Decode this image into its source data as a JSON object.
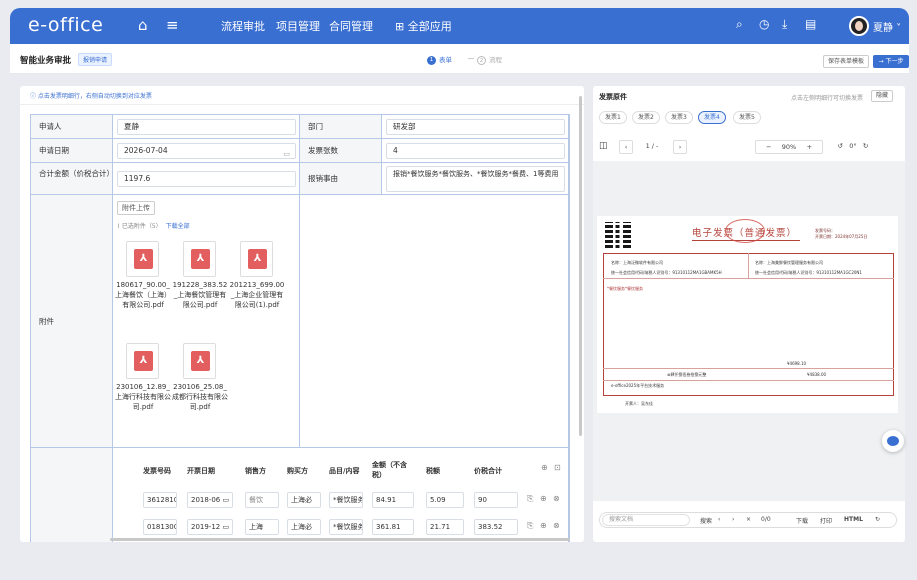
{
  "app": {
    "logo": "e-office",
    "username": "夏静"
  },
  "nav": {
    "links": [
      "流程审批",
      "项目管理",
      "合同管理"
    ],
    "all_apps": "全部应用"
  },
  "sub": {
    "title": "智能业务审批",
    "tag": "报销申请",
    "step1_num": "1",
    "step1": "表单",
    "step2_num": "2",
    "step2": "流程",
    "save_template": "保存表单模板",
    "next": "→ 下一步"
  },
  "form": {
    "hint": "点击发票明细行，右侧自动切换到对应发票",
    "applicant_label": "申请人",
    "applicant": "夏静",
    "dept_label": "部门",
    "dept": "研发部",
    "date_label": "申请日期",
    "date": "2026-07-04",
    "count_label": "发票张数",
    "count": "4",
    "total_label": "合计金额（价税合计）",
    "total": "1197.6",
    "reason_label": "报销事由",
    "reason": "报销*餐饮服务*餐饮服务、*餐饮服务*餐费、1等费用",
    "attachment_label": "附件",
    "upload": "附件上传",
    "selected": "已选附件（5）",
    "download_all": "下载全部",
    "files": [
      {
        "name": "180617_90.00_上海餐饮（上海）有限公司.pdf"
      },
      {
        "name": "191228_383.52_上海餐饮管理有限公司.pdf"
      },
      {
        "name": "201213_699.00_上海企业管理有限公司(1).pdf"
      },
      {
        "name": "230106_12.89_上海行科技有限公司.pdf"
      },
      {
        "name": "230106_25.08_成都行科技有限公司.pdf"
      }
    ]
  },
  "detail": {
    "headers": [
      "发票号码",
      "开票日期",
      "销售方",
      "购买方",
      "品目/内容",
      "金额（不含税）",
      "税额",
      "价税合计"
    ],
    "rows": [
      [
        "3612810",
        "2018-06",
        "餐饮",
        "上海必",
        "*餐饮服务",
        "84.91",
        "5.09",
        "90"
      ],
      [
        "0181300",
        "2019-12",
        "上海",
        "上海必",
        "*餐饮服务",
        "361.81",
        "21.71",
        "383.52"
      ]
    ]
  },
  "invoice": {
    "title": "发票原件",
    "hint": "点击左侧明细行可切换发票",
    "hide": "隐藏",
    "tabs": [
      "发票1",
      "发票2",
      "发票3",
      "发票4",
      "发票5"
    ],
    "page": "1 / -",
    "zoom": "90%",
    "rotation": "0°",
    "doc_title": "电子发票（普通发票）",
    "buyer": "名称：上海泛微软件有限公司",
    "buyer_tax": "统一社会信用代码/纳税人识别号：91310112MA1GBAMK5H",
    "seller": "名称：上海美鲜餐饮管理服务有限公司",
    "seller_tax": "统一社会信用代码/纳税人识别号：91310112MA1GC20N1",
    "item": "*餐饮服务*餐饮服务",
    "amount": "¥4698.10",
    "total_upper": "肆仟捌佰叁拾捌元整",
    "total_lower": "¥4838.00",
    "remark": "e-office2025年平台技术服务",
    "issuer": "开票人：吴东佳",
    "no_label": "发票号码：",
    "date_label": "开票日期：2024年07月25日"
  },
  "viewer_bar": {
    "search_placeholder": "搜索文档",
    "search": "搜索",
    "count": "0/0",
    "download": "下载",
    "print": "打印",
    "html": "HTML"
  },
  "colors": {
    "primary": "#3a6fd2",
    "border": "#b6c8e8",
    "invoice_red": "#b5423a"
  }
}
